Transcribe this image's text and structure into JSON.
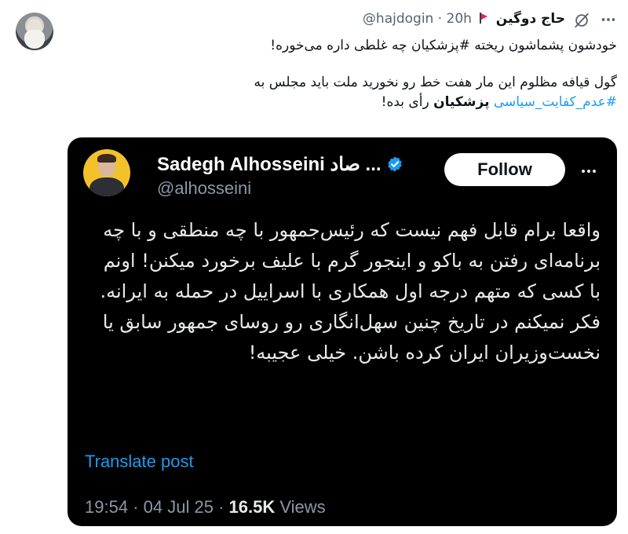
{
  "post": {
    "author_name": "حاج دوگین",
    "handle": "@hajdogin",
    "separator": "·",
    "time": "20h",
    "paragraph1": "خودشون پشماشون ریخته #پزشکیان چه غلطی داره می‌خوره!",
    "p2_line1": "گول قیافه مظلوم این مار هفت خط رو نخورید ملت باید مجلس به",
    "p2_hashtag": "#عدم_کفایت_سیاسی",
    "p2_bold": "پزشکیان",
    "p2_end": "رأی بده!",
    "icons": {
      "grok": "grok-icon",
      "more": "more-horizontal-icon",
      "flag": "red-flag-icon"
    }
  },
  "quoted": {
    "name": "Sadegh Alhosseini",
    "name_suffix": "... صاد",
    "handle": "@alhosseini",
    "follow_label": "Follow",
    "text": "واقعا برام قابل فهم نیست که رئیس‌جمهور با چه منطقی و با چه برنامه‌ای رفتن به باکو و اینجور گرم با علیف برخورد میکنن! اونم با کسی که متهم درجه اول همکاری با اسراییل در حمله به ایرانه. فکر نمیکنم در تاریخ چنین سهل‌انگاری رو روسای جمهور سابق یا نخست‌وزیران ایران کرده باشن. خیلی عجیبه!",
    "translate_label": "Translate post",
    "time": "19:54",
    "date": "04 Jul 25",
    "dot": "·",
    "views_count": "16.5K",
    "views_label": "Views",
    "icons": {
      "verified": "verified-badge-icon",
      "more": "more-horizontal-icon"
    }
  },
  "colors": {
    "link": "#1d9bf0",
    "embed_bg": "#000000",
    "flag": "#e0245e"
  }
}
